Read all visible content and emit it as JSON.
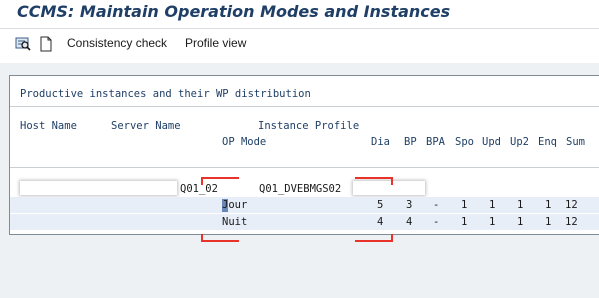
{
  "window": {
    "title": "CCMS: Maintain Operation Modes and Instances"
  },
  "toolbar": {
    "icons": [
      "search-config-icon",
      "new-document-icon"
    ],
    "consistency_check_label": "Consistency check",
    "profile_view_label": "Profile view"
  },
  "panel": {
    "heading": "Productive instances and their WP distribution",
    "headers": {
      "host_name": "Host Name",
      "server_name": "Server Name",
      "instance_profile": "Instance Profile",
      "op_mode": "OP Mode",
      "cols": [
        "Dia",
        "BP",
        "BPA",
        "Spo",
        "Upd",
        "Up2",
        "Enq",
        "Sum"
      ]
    },
    "instance": {
      "server_name": "Q01_02",
      "instance_profile": "Q01_DVEBMGS02"
    },
    "op_modes": [
      {
        "name": "Jour",
        "values": [
          "5",
          "3",
          "-",
          "1",
          "1",
          "1",
          "1",
          "12"
        ]
      },
      {
        "name": "Nuit",
        "values": [
          "4",
          "4",
          "-",
          "1",
          "1",
          "1",
          "1",
          "12"
        ]
      }
    ]
  },
  "colors": {
    "title": "#1f3f66",
    "header_text": "#1f3f66",
    "highlight_row": "#e7eef7",
    "annotation_red": "#e8322a"
  }
}
